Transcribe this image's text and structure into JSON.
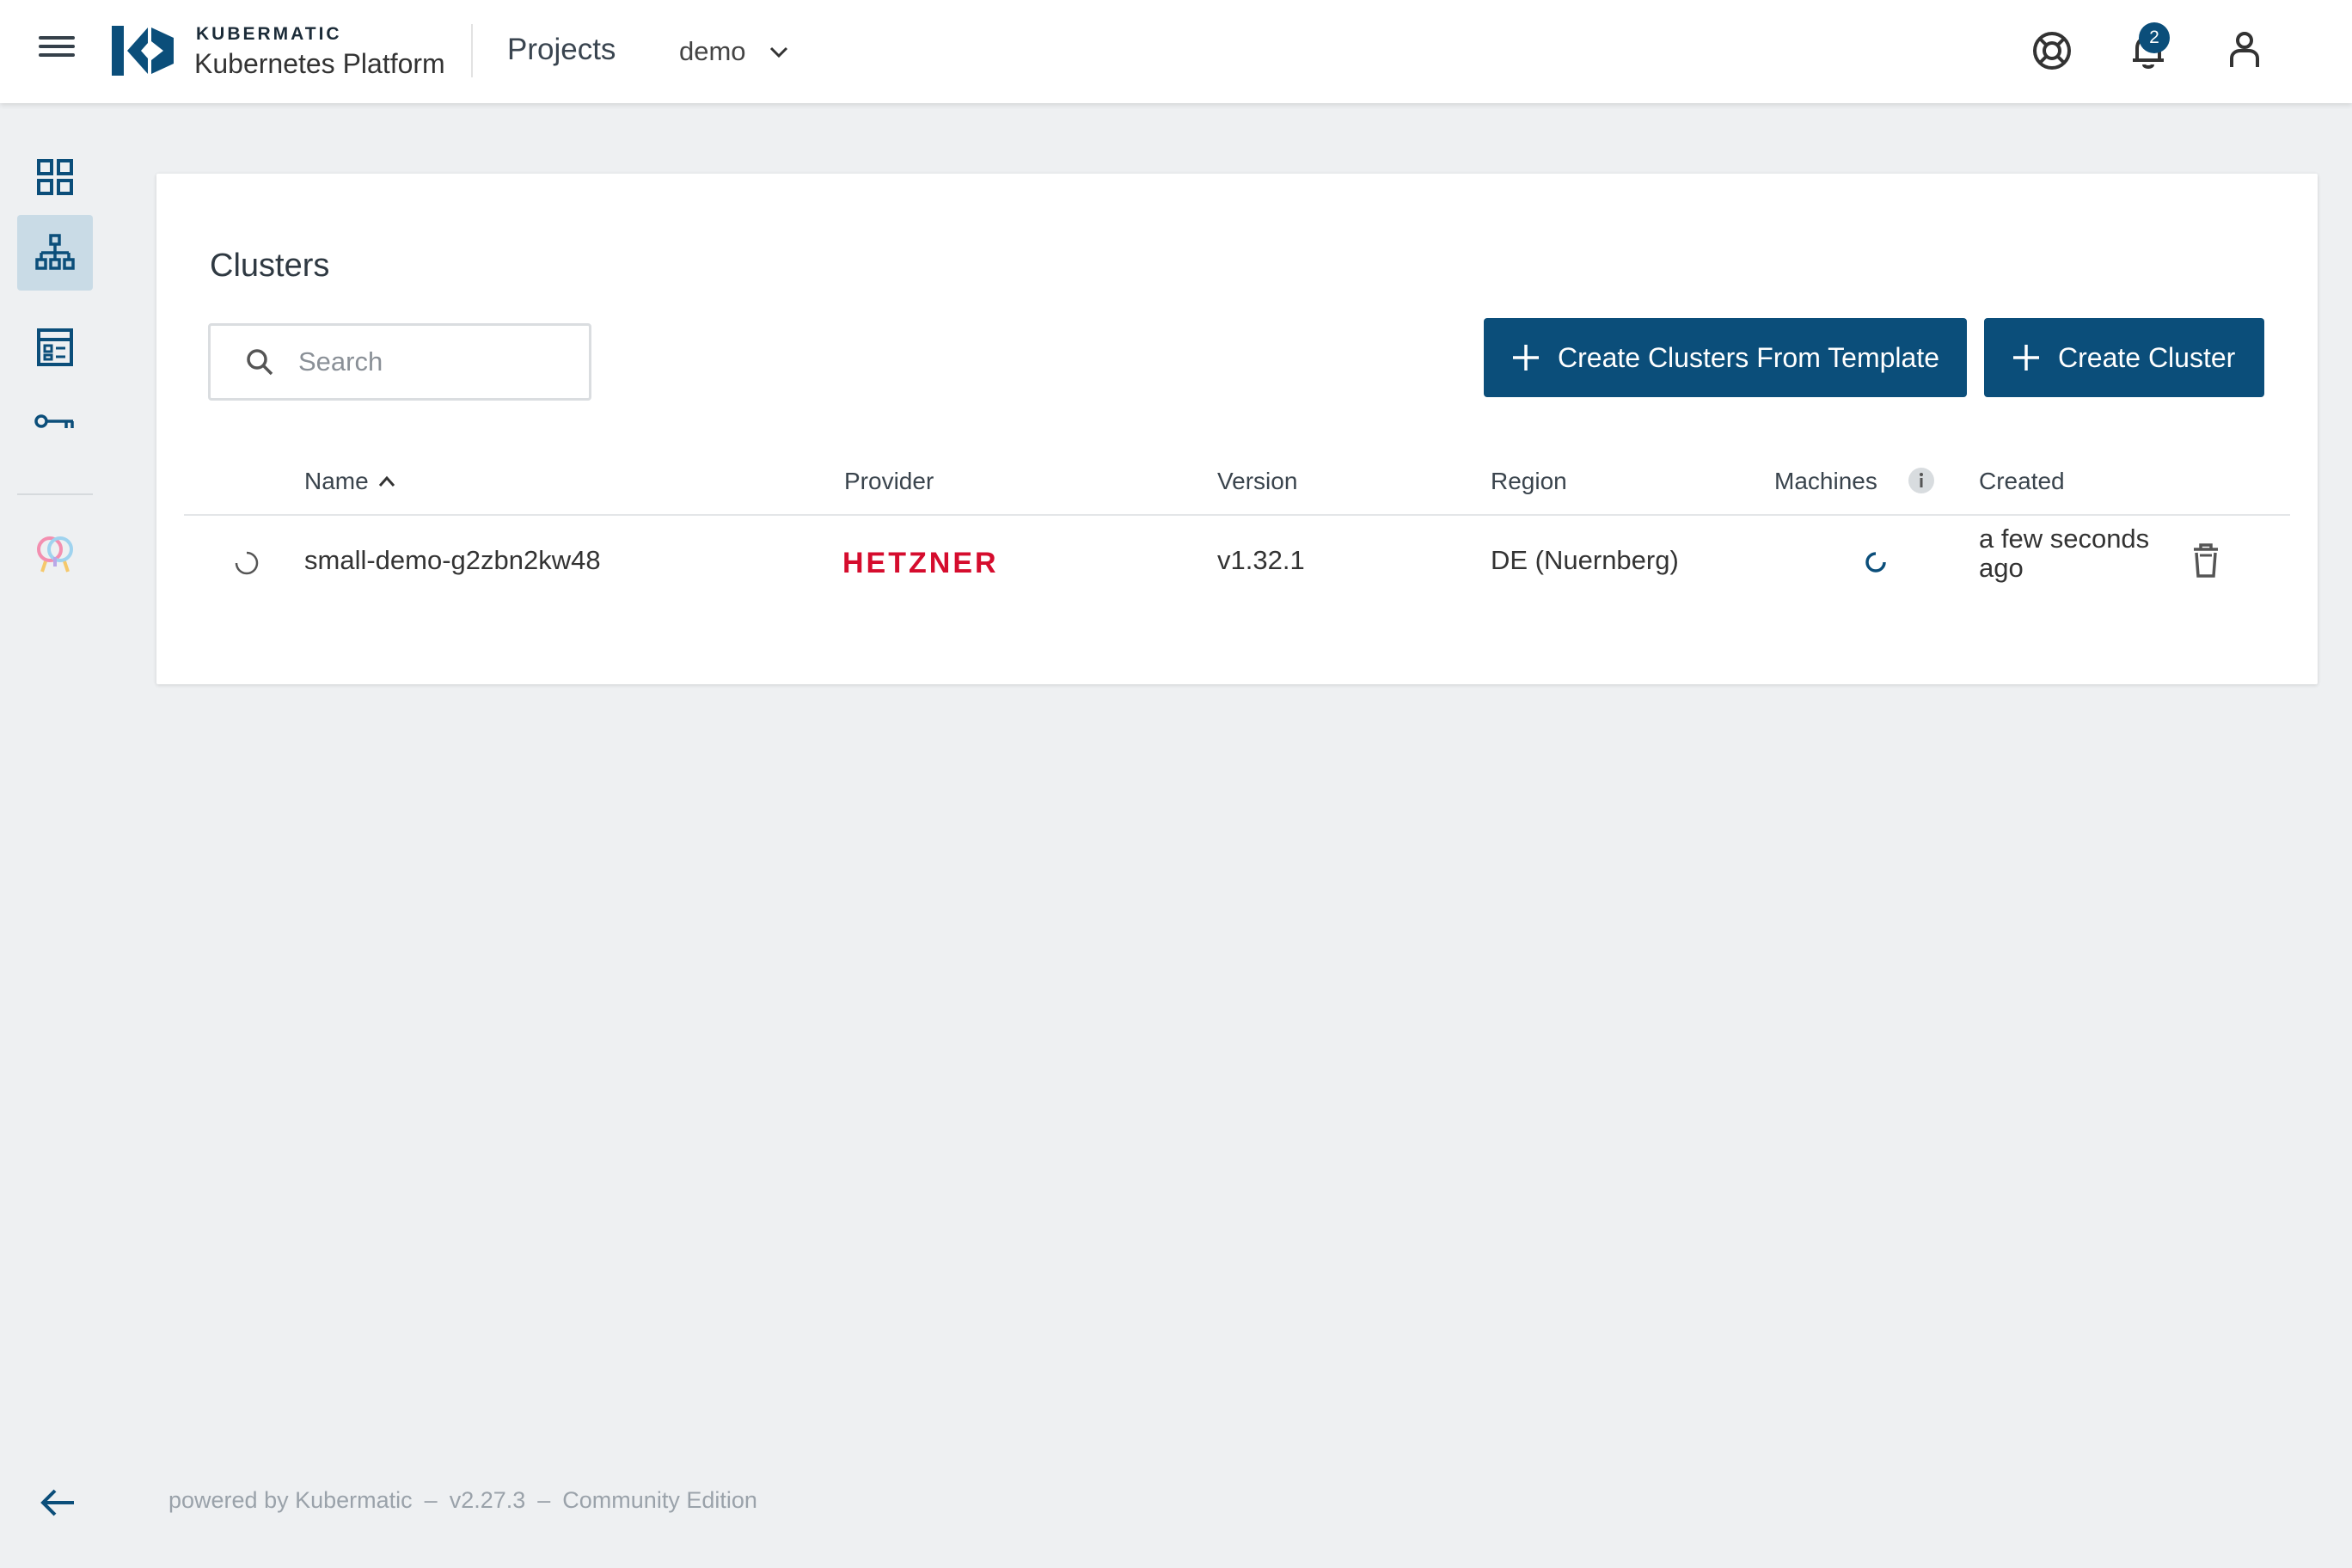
{
  "header": {
    "brand_top": "KUBERMATIC",
    "brand_sub": "Kubernetes Platform",
    "projects_label": "Projects",
    "project_value": "demo",
    "notification_count": "2"
  },
  "clusters": {
    "title": "Clusters",
    "search_placeholder": "Search",
    "create_from_template_label": "Create Clusters From Template",
    "create_cluster_label": "Create Cluster",
    "columns": {
      "name": "Name",
      "provider": "Provider",
      "version": "Version",
      "region": "Region",
      "machines": "Machines",
      "created": "Created"
    },
    "rows": [
      {
        "name": "small-demo-g2zbn2kw48",
        "provider": "HETZNER",
        "version": "v1.32.1",
        "region": "DE (Nuernberg)",
        "created_line1": "a few seconds",
        "created_line2": "ago"
      }
    ]
  },
  "footer": {
    "powered_by": "powered by Kubermatic",
    "version": "v2.27.3",
    "edition": "Community Edition",
    "separator": "–"
  },
  "colors": {
    "primary": "#0b4e7a",
    "hetzner_red": "#d50c2d",
    "background": "#eef0f2",
    "sidebar_active": "#c9dbe6"
  }
}
